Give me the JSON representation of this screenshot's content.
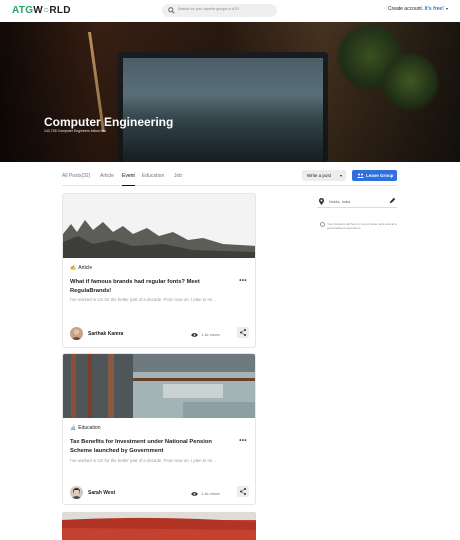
{
  "nav": {
    "logo_part1": "ATG",
    "logo_part2": "W",
    "logo_part3": "RLD",
    "search_placeholder": "Search for your favorite groups in ATG",
    "account_text": "Create account.",
    "account_link": "It's free!"
  },
  "hero": {
    "title": "Computer Engineering",
    "subtitle": "142,765 Computer Engineers follow this"
  },
  "tabs": [
    {
      "label": "All Posts(32)"
    },
    {
      "label": "Article"
    },
    {
      "label": "Event"
    },
    {
      "label": "Education"
    },
    {
      "label": "Job"
    }
  ],
  "actions": {
    "write_post": "Write a post",
    "leave_group": "Leave Group"
  },
  "sidebar": {
    "location": "Noida, India",
    "info": "Your location will help us serve better and extend a personalised experience."
  },
  "posts": [
    {
      "category": "Article",
      "category_emoji": "✍️",
      "title": "What if famous brands had regular fonts? Meet RegulaBrands!",
      "excerpt": "I've worked in UX for the better part of a decade. From now on, I plan to rei...",
      "author": "Sarthak Kamra",
      "views": "1.4k views"
    },
    {
      "category": "Education",
      "category_emoji": "🔬",
      "title": "Tax Benefits for Investment under National Pension Scheme launched by Government",
      "excerpt": "I've worked in UX for the better part of a decade. From now on, I plan to rei...",
      "author": "Sarah West",
      "views": "1.4k views"
    }
  ],
  "colors": {
    "accent_green": "#27a365",
    "accent_blue": "#2f6fde"
  }
}
